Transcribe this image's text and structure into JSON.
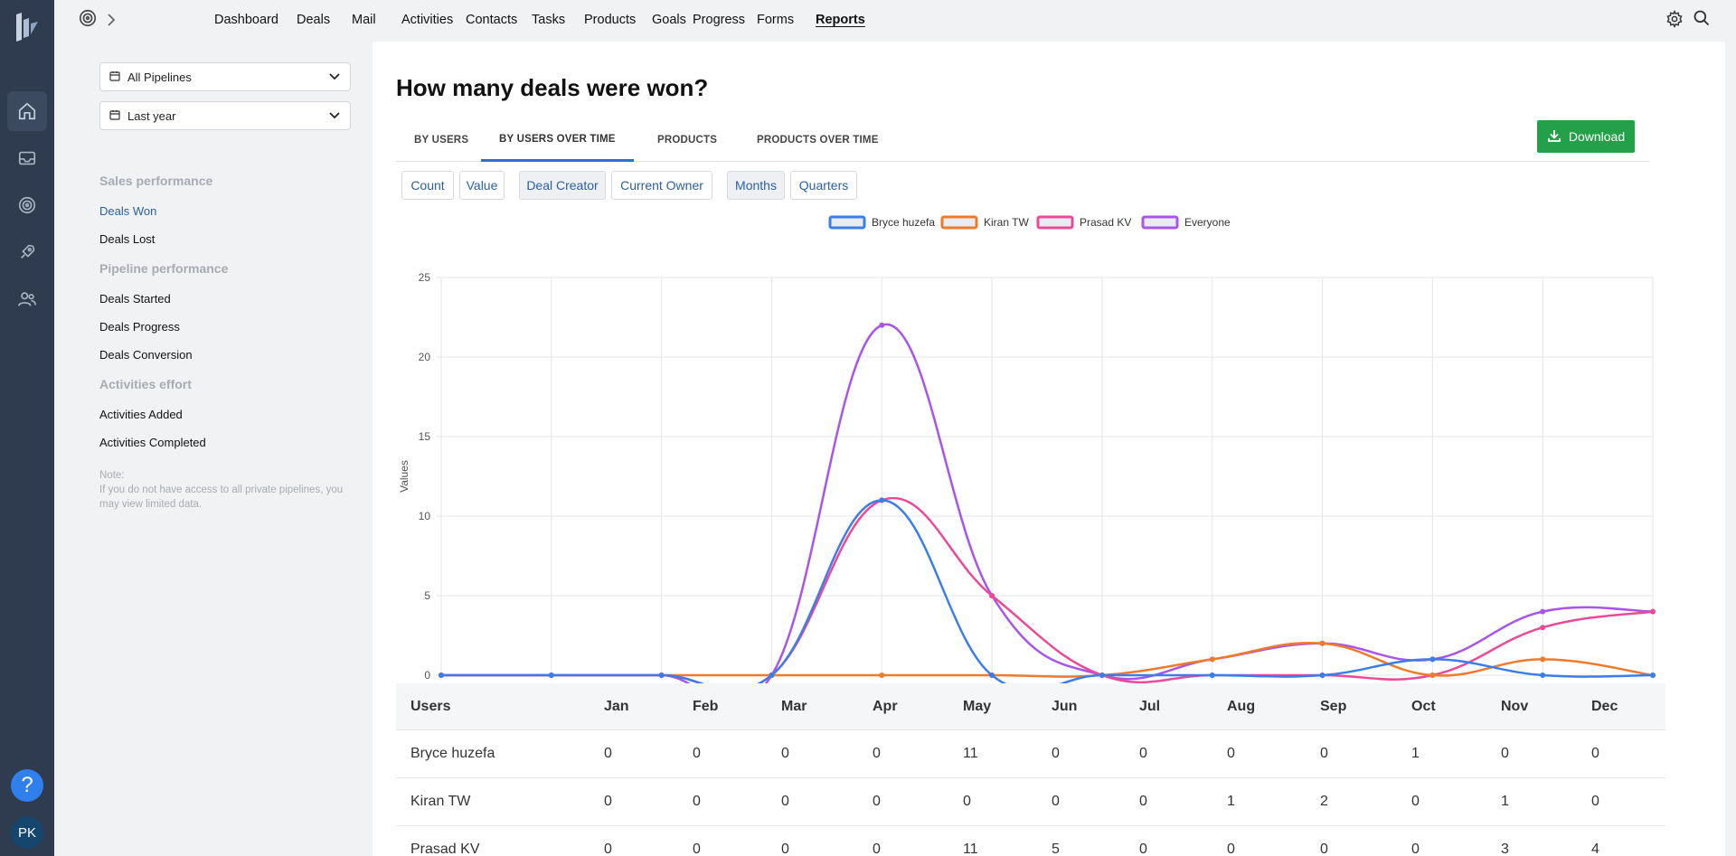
{
  "nav": {
    "items": [
      "Dashboard",
      "Deals",
      "Mail",
      "Activities",
      "Contacts",
      "Tasks",
      "Products",
      "Goals",
      "Progress",
      "Forms",
      "Reports"
    ],
    "active": "Reports"
  },
  "user": {
    "initials": "PK"
  },
  "help": {
    "label": "?"
  },
  "filters": {
    "pipeline": "All Pipelines",
    "period": "Last year"
  },
  "sidebar": {
    "sections": [
      {
        "title": "Sales performance",
        "items": [
          "Deals Won",
          "Deals Lost"
        ]
      },
      {
        "title": "Pipeline performance",
        "items": [
          "Deals Started",
          "Deals Progress",
          "Deals Conversion"
        ]
      },
      {
        "title": "Activities effort",
        "items": [
          "Activities Added",
          "Activities Completed"
        ]
      }
    ],
    "active_item": "Deals Won",
    "note_title": "Note:",
    "note_text": "If you do not have access to all private pipelines, you may view limited data."
  },
  "report": {
    "title": "How many deals were won?",
    "tabs": [
      "BY USERS",
      "BY USERS OVER TIME",
      "PRODUCTS",
      "PRODUCTS OVER TIME"
    ],
    "active_tab": "BY USERS OVER TIME",
    "download_label": "Download",
    "toggles": [
      "Count",
      "Value",
      "Deal Creator",
      "Current Owner",
      "Months",
      "Quarters"
    ],
    "selected_toggles": [
      "Deal Creator",
      "Months"
    ]
  },
  "chart_data": {
    "type": "line",
    "title": "",
    "xlabel": "",
    "ylabel": "Values",
    "ylim": [
      0,
      25
    ],
    "yticks": [
      0,
      5,
      10,
      15,
      20,
      25
    ],
    "grid": true,
    "legend": "top-center",
    "categories": [
      "Jan",
      "Feb",
      "Mar",
      "Apr",
      "May",
      "Jun",
      "Jul",
      "Aug",
      "Sep",
      "Oct",
      "Nov",
      "Dec"
    ],
    "series": [
      {
        "name": "Bryce huzefa",
        "color": "#3b7de9",
        "values": [
          0,
          0,
          0,
          0,
          11,
          0,
          0,
          0,
          0,
          1,
          0,
          0
        ]
      },
      {
        "name": "Kiran TW",
        "color": "#f07a2b",
        "values": [
          0,
          0,
          0,
          0,
          0,
          0,
          0,
          1,
          2,
          0,
          1,
          0
        ]
      },
      {
        "name": "Prasad KV",
        "color": "#ea4a98",
        "values": [
          0,
          0,
          0,
          0,
          11,
          5,
          0,
          0,
          0,
          0,
          3,
          4
        ]
      },
      {
        "name": "Everyone",
        "color": "#a855e8",
        "values": [
          0,
          0,
          0,
          0,
          22,
          5,
          0,
          1,
          2,
          1,
          4,
          4
        ]
      }
    ]
  },
  "table": {
    "header_first": "Users",
    "rows": [
      {
        "user": "Bryce huzefa",
        "values": [
          0,
          0,
          0,
          0,
          11,
          0,
          0,
          0,
          0,
          1,
          0,
          0
        ]
      },
      {
        "user": "Kiran TW",
        "values": [
          0,
          0,
          0,
          0,
          0,
          0,
          0,
          1,
          2,
          0,
          1,
          0
        ]
      },
      {
        "user": "Prasad KV",
        "values": [
          0,
          0,
          0,
          0,
          11,
          5,
          0,
          0,
          0,
          0,
          3,
          4
        ]
      }
    ]
  }
}
